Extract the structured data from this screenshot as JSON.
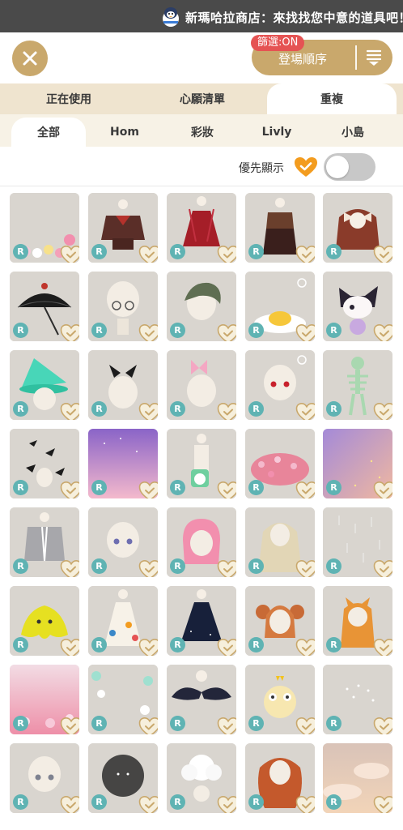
{
  "banner": {
    "text": "新瑪哈拉商店：來找找您中意的道具吧！",
    "mascot_icon": "penguin-mascot-icon"
  },
  "header": {
    "close_icon": "close-icon",
    "filter_badge": "篩選:ON",
    "sort_label": "登場順序",
    "sort_icon": "sort-order-icon"
  },
  "tabs_primary": [
    {
      "label": "正在使用",
      "active": false
    },
    {
      "label": "心願清單",
      "active": false
    },
    {
      "label": "重複",
      "active": true
    }
  ],
  "tabs_secondary": [
    {
      "label": "全部",
      "active": true
    },
    {
      "label": "Hom",
      "active": false
    },
    {
      "label": "彩妝",
      "active": false
    },
    {
      "label": "Livly",
      "active": false
    },
    {
      "label": "小島",
      "active": false
    }
  ],
  "preference": {
    "label": "優先顯示",
    "heart_icon": "orange-heart-check-icon",
    "toggle_on": false
  },
  "colors": {
    "gold": "#c9a86c",
    "badge_red": "#e55353",
    "rarity_teal": "#5fb3b3",
    "tab_bg": "#efe4cf"
  },
  "items": [
    {
      "rarity": "R",
      "theme": "pastel-flowers"
    },
    {
      "rarity": "R",
      "theme": "sailor-uniform"
    },
    {
      "rarity": "R",
      "theme": "red-dress"
    },
    {
      "rarity": "R",
      "theme": "hakama"
    },
    {
      "rarity": "R",
      "theme": "brown-hair-bows"
    },
    {
      "rarity": "R",
      "theme": "black-parasol"
    },
    {
      "rarity": "R",
      "theme": "round-glasses"
    },
    {
      "rarity": "R",
      "theme": "green-hair"
    },
    {
      "rarity": "R",
      "theme": "gudetama-egg"
    },
    {
      "rarity": "R",
      "theme": "kuromi-plush"
    },
    {
      "rarity": "R",
      "theme": "teal-witch-hat"
    },
    {
      "rarity": "R",
      "theme": "black-cat-ears"
    },
    {
      "rarity": "R",
      "theme": "pink-bow"
    },
    {
      "rarity": "R",
      "theme": "red-eyes"
    },
    {
      "rarity": "R",
      "theme": "green-skeleton"
    },
    {
      "rarity": "R",
      "theme": "bats"
    },
    {
      "rarity": "R",
      "theme": "pink-sky"
    },
    {
      "rarity": "R",
      "theme": "pochacco-bag"
    },
    {
      "rarity": "R",
      "theme": "pink-flower-mound"
    },
    {
      "rarity": "R",
      "theme": "sparkle-gradient"
    },
    {
      "rarity": "R",
      "theme": "grey-jacket"
    },
    {
      "rarity": "R",
      "theme": "purple-eyes"
    },
    {
      "rarity": "R",
      "theme": "pink-hair"
    },
    {
      "rarity": "R",
      "theme": "long-blonde-hair"
    },
    {
      "rarity": "R",
      "theme": "rain"
    },
    {
      "rarity": "R",
      "theme": "yellow-slime"
    },
    {
      "rarity": "R",
      "theme": "pom-pom-dress"
    },
    {
      "rarity": "R",
      "theme": "navy-dress"
    },
    {
      "rarity": "R",
      "theme": "orange-buns-hair"
    },
    {
      "rarity": "R",
      "theme": "orange-fox-hoodie"
    },
    {
      "rarity": "R",
      "theme": "cherry-blossoms"
    },
    {
      "rarity": "R",
      "theme": "teal-flower-frame"
    },
    {
      "rarity": "R",
      "theme": "black-wings"
    },
    {
      "rarity": "R",
      "theme": "popcorn-creature"
    },
    {
      "rarity": "R",
      "theme": "twinkle-stars"
    },
    {
      "rarity": "R",
      "theme": "grey-eyes"
    },
    {
      "rarity": "R",
      "theme": "black-fuzz"
    },
    {
      "rarity": "R",
      "theme": "white-flower"
    },
    {
      "rarity": "R",
      "theme": "orange-wavy-hair"
    },
    {
      "rarity": "R",
      "theme": "sunset-clouds"
    }
  ]
}
